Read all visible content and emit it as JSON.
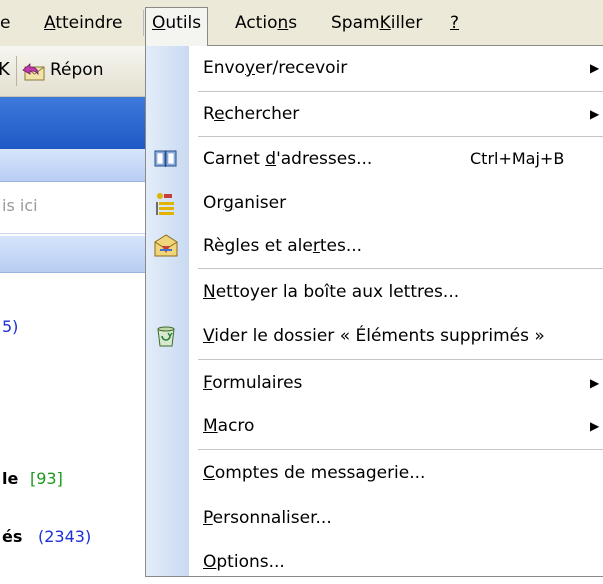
{
  "menubar": {
    "fragment_left": "e",
    "atteindre": {
      "pre": "",
      "ul": "A",
      "post": "tteindre"
    },
    "outils": {
      "pre": "",
      "ul": "O",
      "post": "utils"
    },
    "actions": {
      "pre": "Actio",
      "ul": "n",
      "post": "s"
    },
    "spamkiller": {
      "pre": "Spam",
      "ul": "K",
      "post": "iller"
    },
    "help": {
      "pre": "",
      "ul": "?",
      "post": ""
    }
  },
  "left_pane": {
    "toolbar_x": "K",
    "toolbar_reply": "Répon",
    "search_hint": "is ici",
    "count_frag": "5)",
    "le_label": "le",
    "le_count": "[93]",
    "es_label": "és",
    "es_count": "(2343)"
  },
  "menu": {
    "items": [
      {
        "pre": "Envo",
        "ul": "y",
        "post": "er/recevoir",
        "shortcut": "",
        "arrow": "▶",
        "icon": ""
      },
      {
        "pre": "R",
        "ul": "e",
        "post": "chercher",
        "shortcut": "",
        "arrow": "▶",
        "icon": ""
      },
      {
        "pre": "Carnet ",
        "ul": "d",
        "post": "'adresses...",
        "shortcut": "Ctrl+Maj+B",
        "arrow": "",
        "icon": "address-book-icon"
      },
      {
        "pre": "Or",
        "ul": "g",
        "post": "aniser",
        "shortcut": "",
        "arrow": "",
        "icon": "organize-icon"
      },
      {
        "pre": "Règles et ale",
        "ul": "r",
        "post": "tes...",
        "shortcut": "",
        "arrow": "",
        "icon": "rules-alerts-icon"
      },
      {
        "pre": "",
        "ul": "N",
        "post": "ettoyer la boîte aux lettres...",
        "shortcut": "",
        "arrow": "",
        "icon": ""
      },
      {
        "pre": "",
        "ul": "V",
        "post": "ider le dossier « Éléments supprimés »",
        "shortcut": "",
        "arrow": "",
        "icon": "trash-icon"
      },
      {
        "pre": "",
        "ul": "F",
        "post": "ormulaires",
        "shortcut": "",
        "arrow": "▶",
        "icon": ""
      },
      {
        "pre": "",
        "ul": "M",
        "post": "acro",
        "shortcut": "",
        "arrow": "▶",
        "icon": ""
      },
      {
        "pre": "",
        "ul": "C",
        "post": "omptes de messagerie...",
        "shortcut": "",
        "arrow": "",
        "icon": ""
      },
      {
        "pre": "",
        "ul": "P",
        "post": "ersonnaliser...",
        "shortcut": "",
        "arrow": "",
        "icon": ""
      },
      {
        "pre": "",
        "ul": "O",
        "post": "ptions...",
        "shortcut": "",
        "arrow": "",
        "icon": ""
      }
    ]
  }
}
